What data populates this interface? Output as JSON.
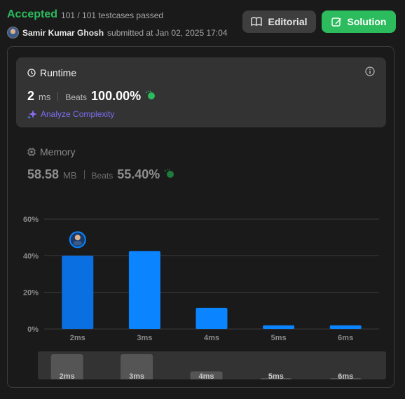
{
  "header": {
    "status": "Accepted",
    "testcases": "101 / 101 testcases passed",
    "username": "Samir Kumar Ghosh",
    "submitted_text": "submitted at Jan 02, 2025 17:04",
    "editorial_label": "Editorial",
    "solution_label": "Solution"
  },
  "runtime": {
    "title": "Runtime",
    "value": "2",
    "unit": "ms",
    "beats_label": "Beats",
    "beats_value": "100.00%",
    "analyze_label": "Analyze Complexity"
  },
  "memory": {
    "title": "Memory",
    "value": "58.58",
    "unit": "MB",
    "beats_label": "Beats",
    "beats_value": "55.40%"
  },
  "colors": {
    "accepted": "#2cbb5d",
    "bar_user": "#0a6fe0",
    "bar": "#0a84ff",
    "analyze": "#7c6ef0"
  },
  "chart_data": {
    "type": "bar",
    "categories": [
      "2ms",
      "3ms",
      "4ms",
      "5ms",
      "6ms"
    ],
    "values": [
      40,
      42.5,
      11.5,
      2,
      2
    ],
    "ylim": [
      0,
      60
    ],
    "yticks": [
      "0%",
      "20%",
      "40%",
      "60%"
    ],
    "highlight_category": "2ms",
    "grid": true
  },
  "brush": {
    "labels": [
      "2ms",
      "3ms",
      "4ms",
      "5ms",
      "6ms"
    ]
  }
}
